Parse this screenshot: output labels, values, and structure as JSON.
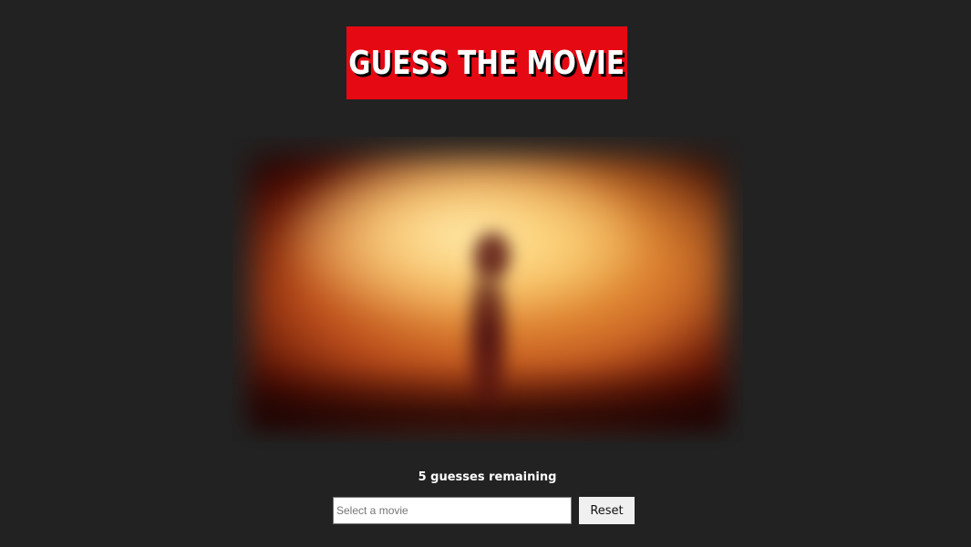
{
  "header": {
    "title": "GUESS THE MOVIE"
  },
  "game": {
    "guesses_remaining_text": "5 guesses remaining",
    "search": {
      "placeholder": "Select a movie",
      "value": ""
    },
    "reset_label": "Reset"
  },
  "colors": {
    "background": "#222222",
    "title_background": "#e50914",
    "title_text": "#ffffff"
  }
}
